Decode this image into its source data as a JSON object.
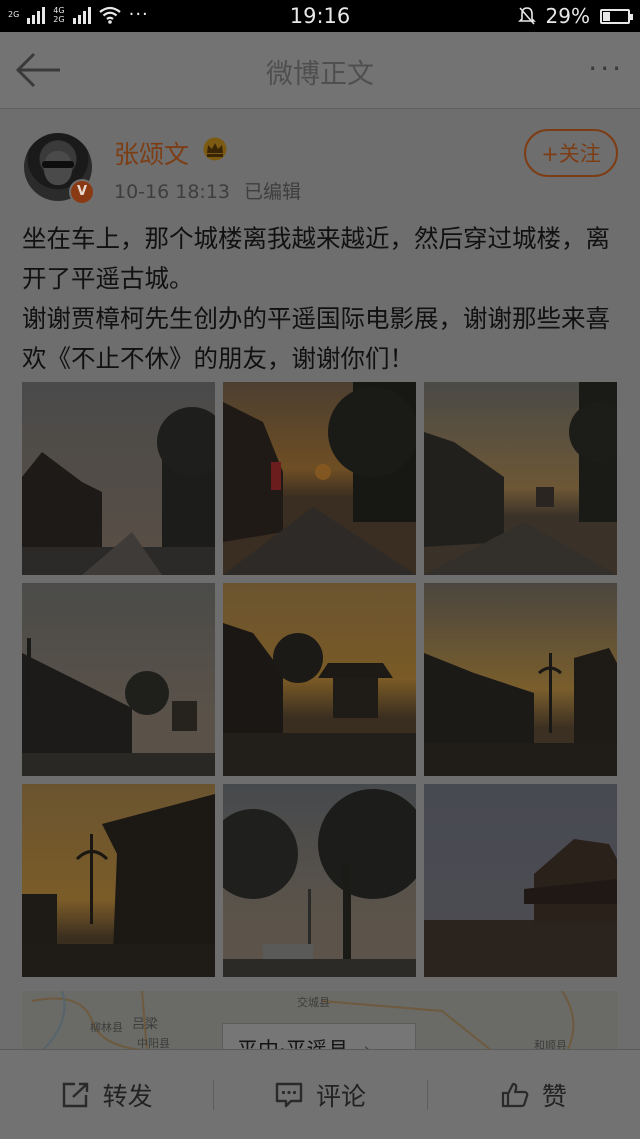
{
  "status_bar": {
    "time": "19:16",
    "battery": "29%",
    "battery_level": 0.29,
    "sim1": "2G",
    "sim2_top": "4G",
    "sim2_bottom": "2G",
    "more": "···"
  },
  "nav": {
    "title": "微博正文",
    "more": "···"
  },
  "post": {
    "username": "张颂文",
    "timestamp": "10-16 18:13",
    "edited": "已编辑",
    "verified_badge": "V",
    "follow_label": "+关注",
    "text": [
      "坐在车上，那个城楼离我越来越近，然后穿过城楼，离开了平遥古城。",
      "谢谢贾樟柯先生创办的平遥国际电影展，谢谢那些来喜欢《不止不休》的朋友，谢谢你们！"
    ],
    "photos_count": 9
  },
  "map": {
    "labels": [
      "交城县",
      "柳林县",
      "吕梁",
      "中阳县",
      "和顺县"
    ],
    "location_card": "平中·平遥县",
    "chevron": "›"
  },
  "toolbar": {
    "repost": "转发",
    "comment": "评论",
    "like": "赞"
  },
  "colors": {
    "brand_orange": "#7d3d14",
    "dim_overlay": "#6e6e6e"
  }
}
